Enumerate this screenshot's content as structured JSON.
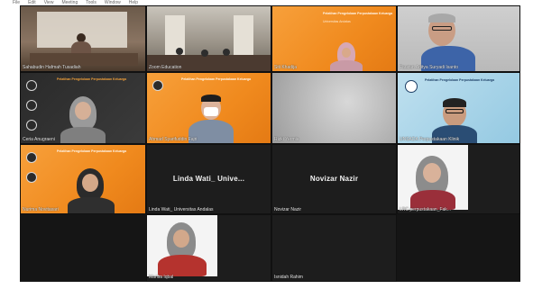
{
  "menubar": [
    "File",
    "Edit",
    "View",
    "Meeting",
    "Tools",
    "Window",
    "Help"
  ],
  "participants": [
    {
      "id": "p1",
      "label": "Sahabudin Hafmah Tusadiah"
    },
    {
      "id": "p2",
      "label": "Zoom Education"
    },
    {
      "id": "p3",
      "label": "Siti Khadija"
    },
    {
      "id": "p4",
      "label": "Fauzan Aditya Suryadi Isanto"
    },
    {
      "id": "p5",
      "label": "Ceria Anugraeni"
    },
    {
      "id": "p6",
      "label": "Ahmad Syarifuddin Fajri"
    },
    {
      "id": "p7",
      "label": "Rizki Yermia"
    },
    {
      "id": "p8",
      "label": "UNSADA Perpustakaan Klinik"
    },
    {
      "id": "p9",
      "label": "Nurima Novitasari"
    },
    {
      "id": "p10",
      "label": "Linda Wati_ Universitas Andalas",
      "big_name": "Linda Wati_ Unive..."
    },
    {
      "id": "p11",
      "label": "Novizar Nazir",
      "big_name": "Novizar Nazir"
    },
    {
      "id": "p12",
      "label": "LRC perpustakaan_Fak..."
    },
    {
      "id": "p13",
      "label": "Marisa Iqbal"
    },
    {
      "id": "p14",
      "label": "Isnidah Rahim"
    }
  ],
  "slide": {
    "heading": "Pelatihan Pengelolaan Perpustakaan Keluarga",
    "subheading": "Universitas Andalas"
  }
}
